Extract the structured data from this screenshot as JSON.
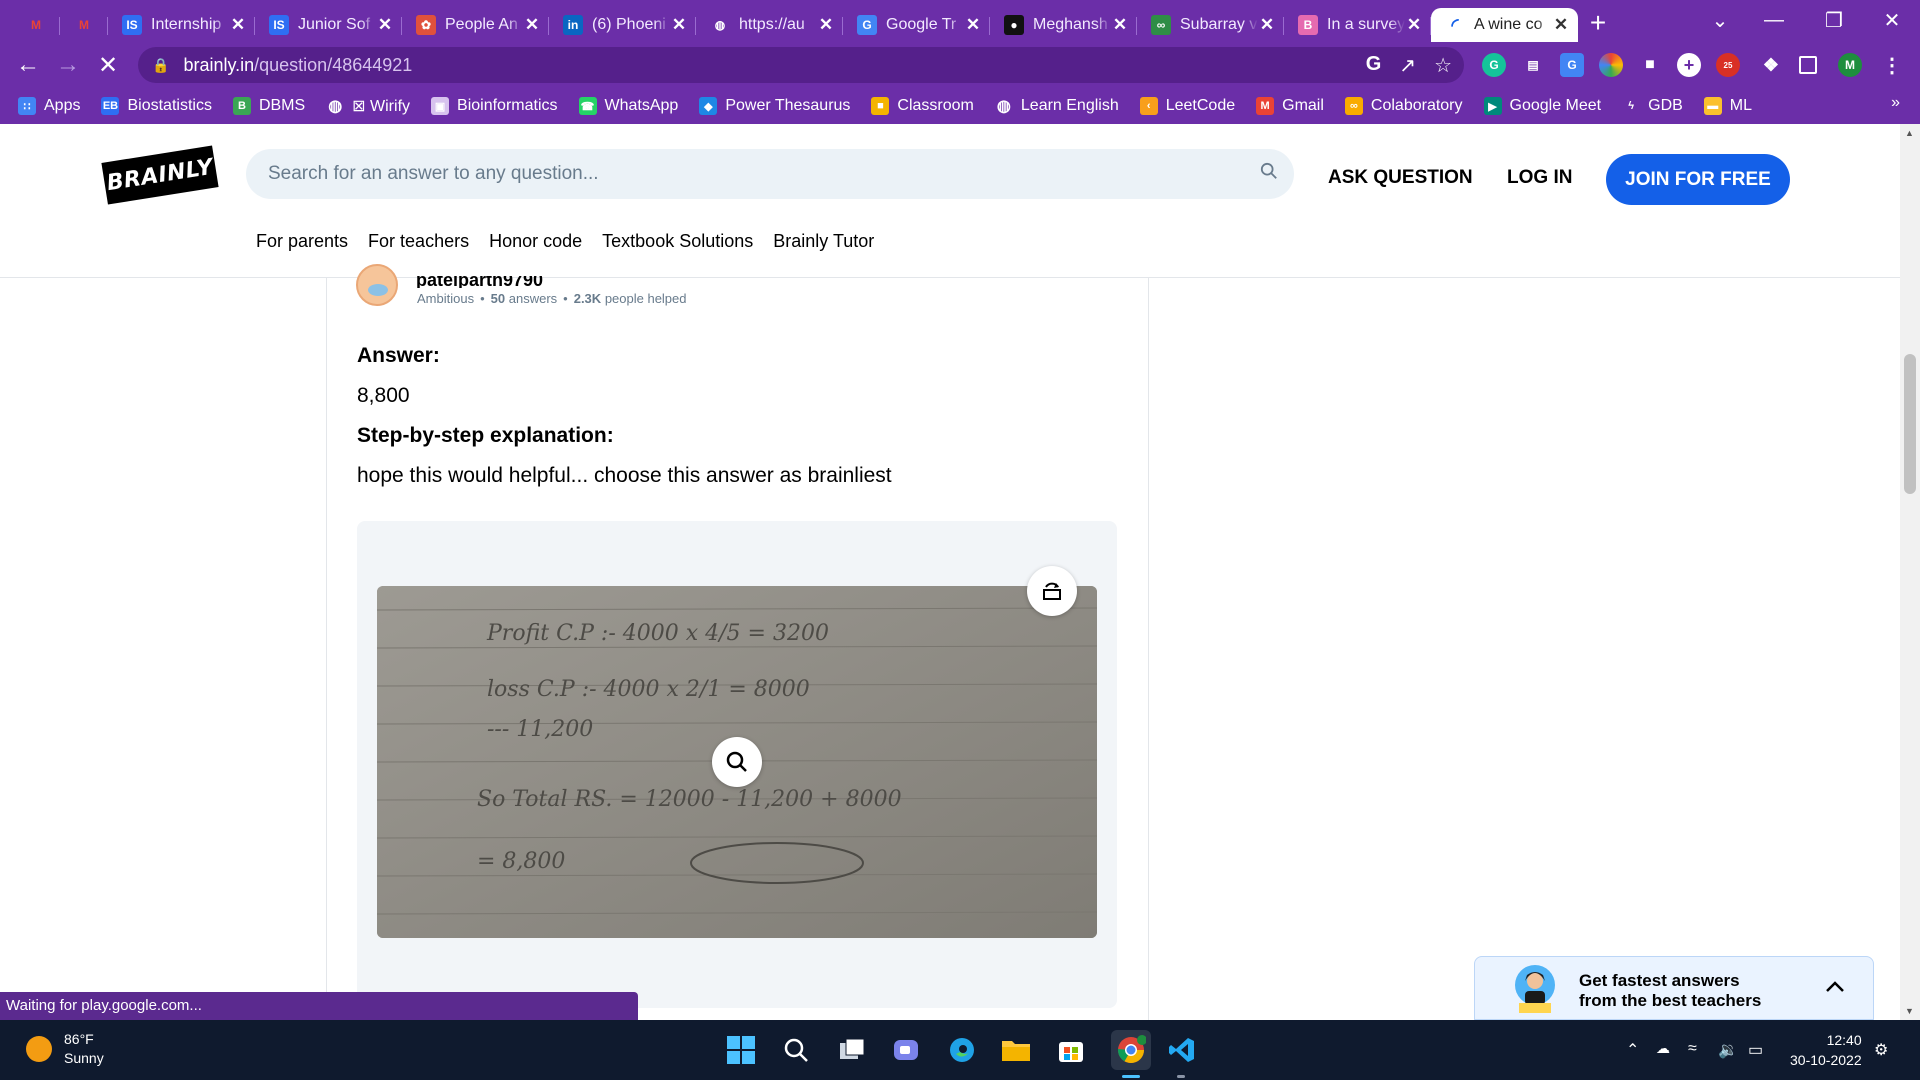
{
  "browser": {
    "tabs": [
      {
        "title": "",
        "icon": "gmail-icon",
        "color": "#ffffff",
        "glyph": "M",
        "pinned": true
      },
      {
        "title": "",
        "icon": "gmail-icon",
        "color": "#ffffff",
        "glyph": "M",
        "pinned": true
      },
      {
        "title": "Internship",
        "icon": "is-icon",
        "color": "#2f6ef3",
        "glyph": "IS"
      },
      {
        "title": "Junior Sof",
        "icon": "is-icon",
        "color": "#2f6ef3",
        "glyph": "IS"
      },
      {
        "title": "People An",
        "icon": "people-icon",
        "color": "#e0513c",
        "glyph": "✿"
      },
      {
        "title": "(6) Phoeni",
        "icon": "linkedin-icon",
        "color": "#0a66c2",
        "glyph": "in"
      },
      {
        "title": "https://au",
        "icon": "globe-icon",
        "color": "#6b2ea8",
        "glyph": "◍"
      },
      {
        "title": "Google Tr",
        "icon": "google-translate-icon",
        "color": "#4285f4",
        "glyph": "G"
      },
      {
        "title": "Meghansh",
        "icon": "github-icon",
        "color": "#111111",
        "glyph": "●"
      },
      {
        "title": "Subarray v",
        "icon": "gfg-icon",
        "color": "#2f8d46",
        "glyph": "∞"
      },
      {
        "title": "In a survey",
        "icon": "brainly-icon",
        "color": "#e56bb0",
        "glyph": "B"
      },
      {
        "title": "A wine co",
        "icon": "loading-icon",
        "color": "#1460e8",
        "glyph": "◜",
        "active": true
      }
    ],
    "new_tab": "+",
    "url_host": "brainly.in",
    "url_path": "/question/48644921",
    "bookmarks": [
      {
        "label": "Apps",
        "icon": "apps-grid-icon",
        "color": "#4285f4",
        "glyph": "∷"
      },
      {
        "label": "Biostatistics",
        "icon": "eb-icon",
        "color": "#2f6ef3",
        "glyph": "EB"
      },
      {
        "label": "DBMS",
        "icon": "b-icon",
        "color": "#3aa655",
        "glyph": "B"
      },
      {
        "label": "⊠ Wirify",
        "icon": "globe-icon",
        "color": "#ffffff",
        "glyph": "◍"
      },
      {
        "label": "Bioinformatics",
        "icon": "bio-icon",
        "color": "#d7c3ee",
        "glyph": "▣"
      },
      {
        "label": "WhatsApp",
        "icon": "whatsapp-icon",
        "color": "#25d366",
        "glyph": "☎"
      },
      {
        "label": "Power Thesaurus",
        "icon": "thesaurus-icon",
        "color": "#1e88e5",
        "glyph": "◆"
      },
      {
        "label": "Classroom",
        "icon": "classroom-icon",
        "color": "#f4b400",
        "glyph": "■"
      },
      {
        "label": "Learn English",
        "icon": "globe-icon",
        "color": "#ffffff",
        "glyph": "◍"
      },
      {
        "label": "LeetCode",
        "icon": "leetcode-icon",
        "color": "#f89f1b",
        "glyph": "‹"
      },
      {
        "label": "Gmail",
        "icon": "gmail-icon",
        "color": "#ea4335",
        "glyph": "M"
      },
      {
        "label": "Colaboratory",
        "icon": "colab-icon",
        "color": "#f9ab00",
        "glyph": "∞"
      },
      {
        "label": "Google Meet",
        "icon": "meet-icon",
        "color": "#00897b",
        "glyph": "▶"
      },
      {
        "label": "GDB",
        "icon": "gdb-icon",
        "color": "#6b2ea8",
        "glyph": "ϟ"
      },
      {
        "label": "ML",
        "icon": "folder-icon",
        "color": "#fbc02d",
        "glyph": "▬"
      }
    ],
    "bookmarks_more": "»",
    "ext_badge": "25",
    "profile_initial": "M",
    "status_text": "Waiting for play.google.com..."
  },
  "site": {
    "logo": "BRAINLY",
    "search_placeholder": "Search for an answer to any question...",
    "ask_question": "ASK QUESTION",
    "log_in": "LOG IN",
    "join": "JOIN FOR FREE",
    "subnav": [
      "For parents",
      "For teachers",
      "Honor code",
      "Textbook Solutions",
      "Brainly Tutor"
    ]
  },
  "answer": {
    "username": "patelparth9790",
    "rank": "Ambitious",
    "answers_count": "50",
    "answers_label": "answers",
    "helped_count": "2.3K",
    "helped_label": "people helped",
    "answer_heading": "Answer:",
    "answer_value": "8,800",
    "step_heading": "Step-by-step explanation:",
    "step_text": "hope this would helpful... choose this answer as brainliest",
    "photo_lines": [
      "Profit  C.P :-   4000 x 4/5  =  3200",
      "loss  C.P :-   4000 x 2/1  =  8000",
      "                          ---  11,200",
      "So  Total  RS. = 12000 - 11,200 + 8000",
      "              = 8,800"
    ]
  },
  "promo": {
    "line1": "Get fastest answers",
    "line2": "from the best teachers"
  },
  "taskbar": {
    "temp": "86°F",
    "condition": "Sunny",
    "time": "12:40",
    "date": "30-10-2022"
  }
}
